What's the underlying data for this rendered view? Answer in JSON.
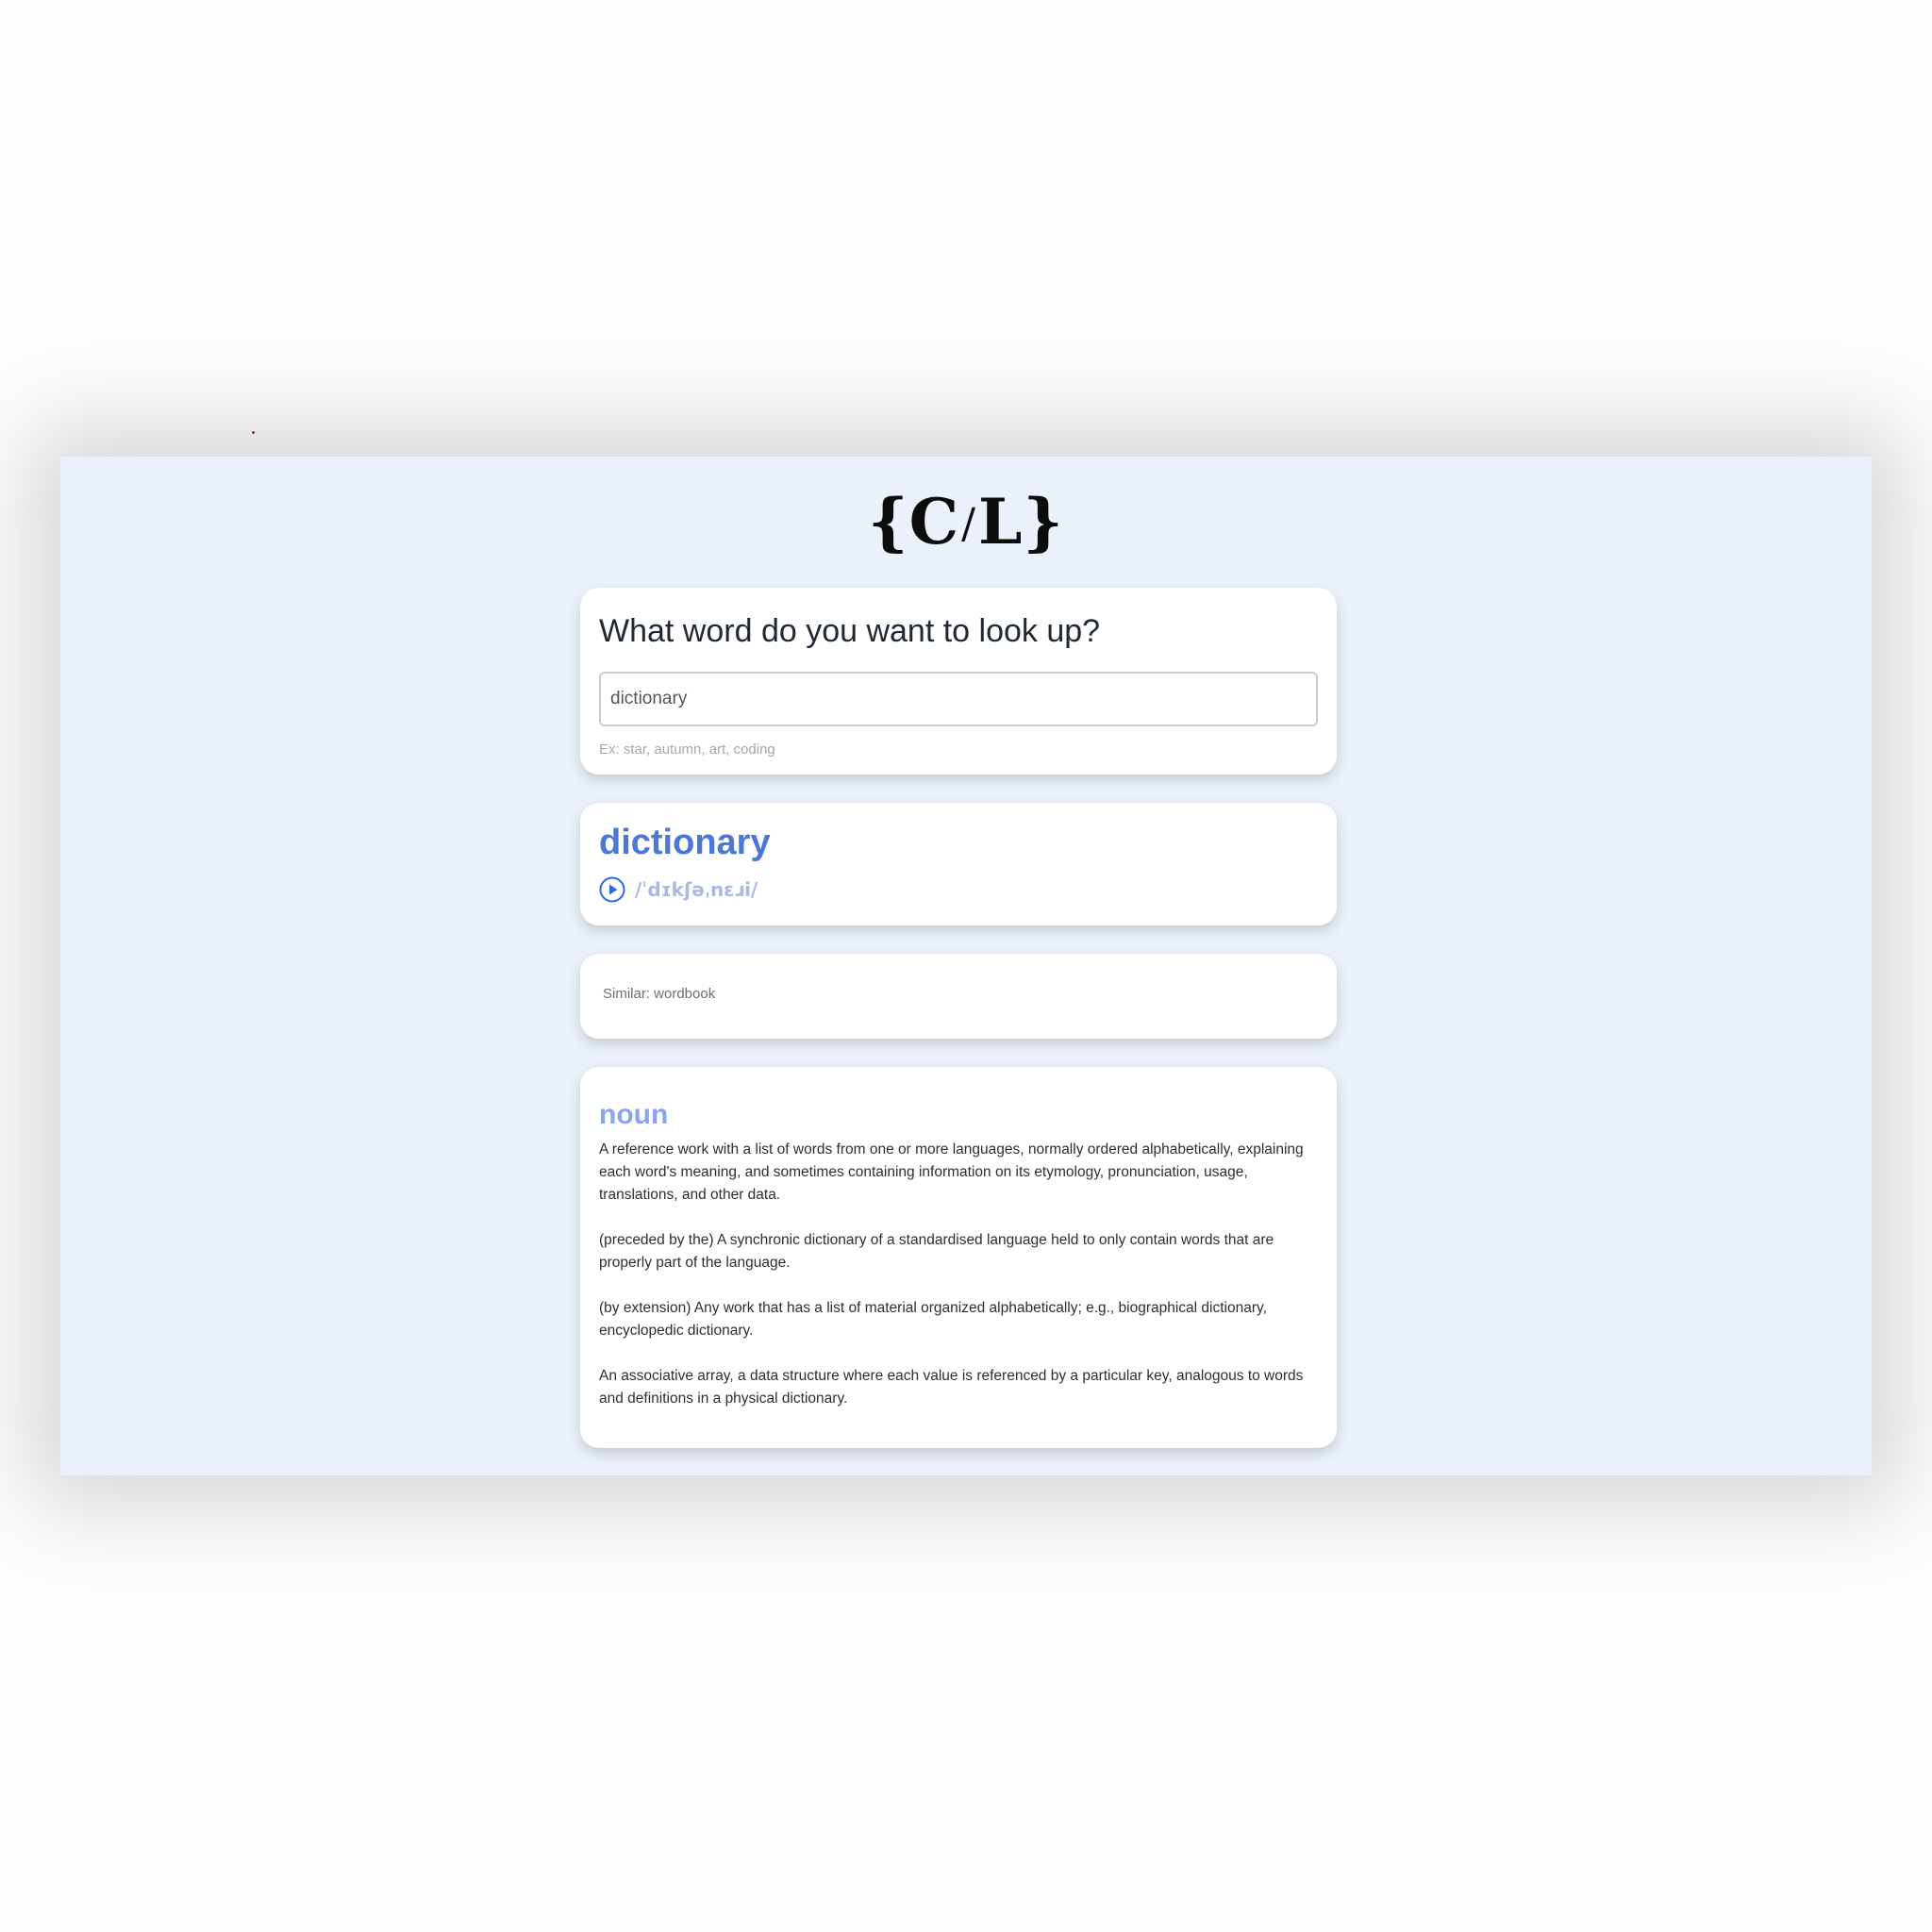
{
  "logo": {
    "open": "{C",
    "slash": "/",
    "close": "L}"
  },
  "search": {
    "question": "What word do you want to look up?",
    "value": "dictionary",
    "hint": "Ex: star, autumn, art, coding"
  },
  "word": {
    "headword": "dictionary",
    "phonetic": "/ˈdɪkʃəˌnɛɹi/",
    "play_icon": "play-circle-icon"
  },
  "similar": {
    "text": "Similar: wordbook"
  },
  "meaning": {
    "part_of_speech": "noun",
    "definitions": [
      "A reference work with a list of words from one or more languages, normally ordered alphabetically, explaining each word's meaning, and sometimes containing information on its etymology, pronunciation, usage, translations, and other data.",
      "(preceded by the) A synchronic dictionary of a standardised language held to only contain words that are properly part of the language.",
      "(by extension) Any work that has a list of material organized alphabetically; e.g., biographical dictionary, encyclopedic dictionary.",
      "An associative array, a data structure where each value is referenced by a particular key, analogous to words and definitions in a physical dictionary."
    ]
  },
  "colors": {
    "background": "#ebf1fa",
    "accent": "#4a78d6",
    "phonetic": "#a7b9e6",
    "play_icon": "#2a6ae8"
  }
}
